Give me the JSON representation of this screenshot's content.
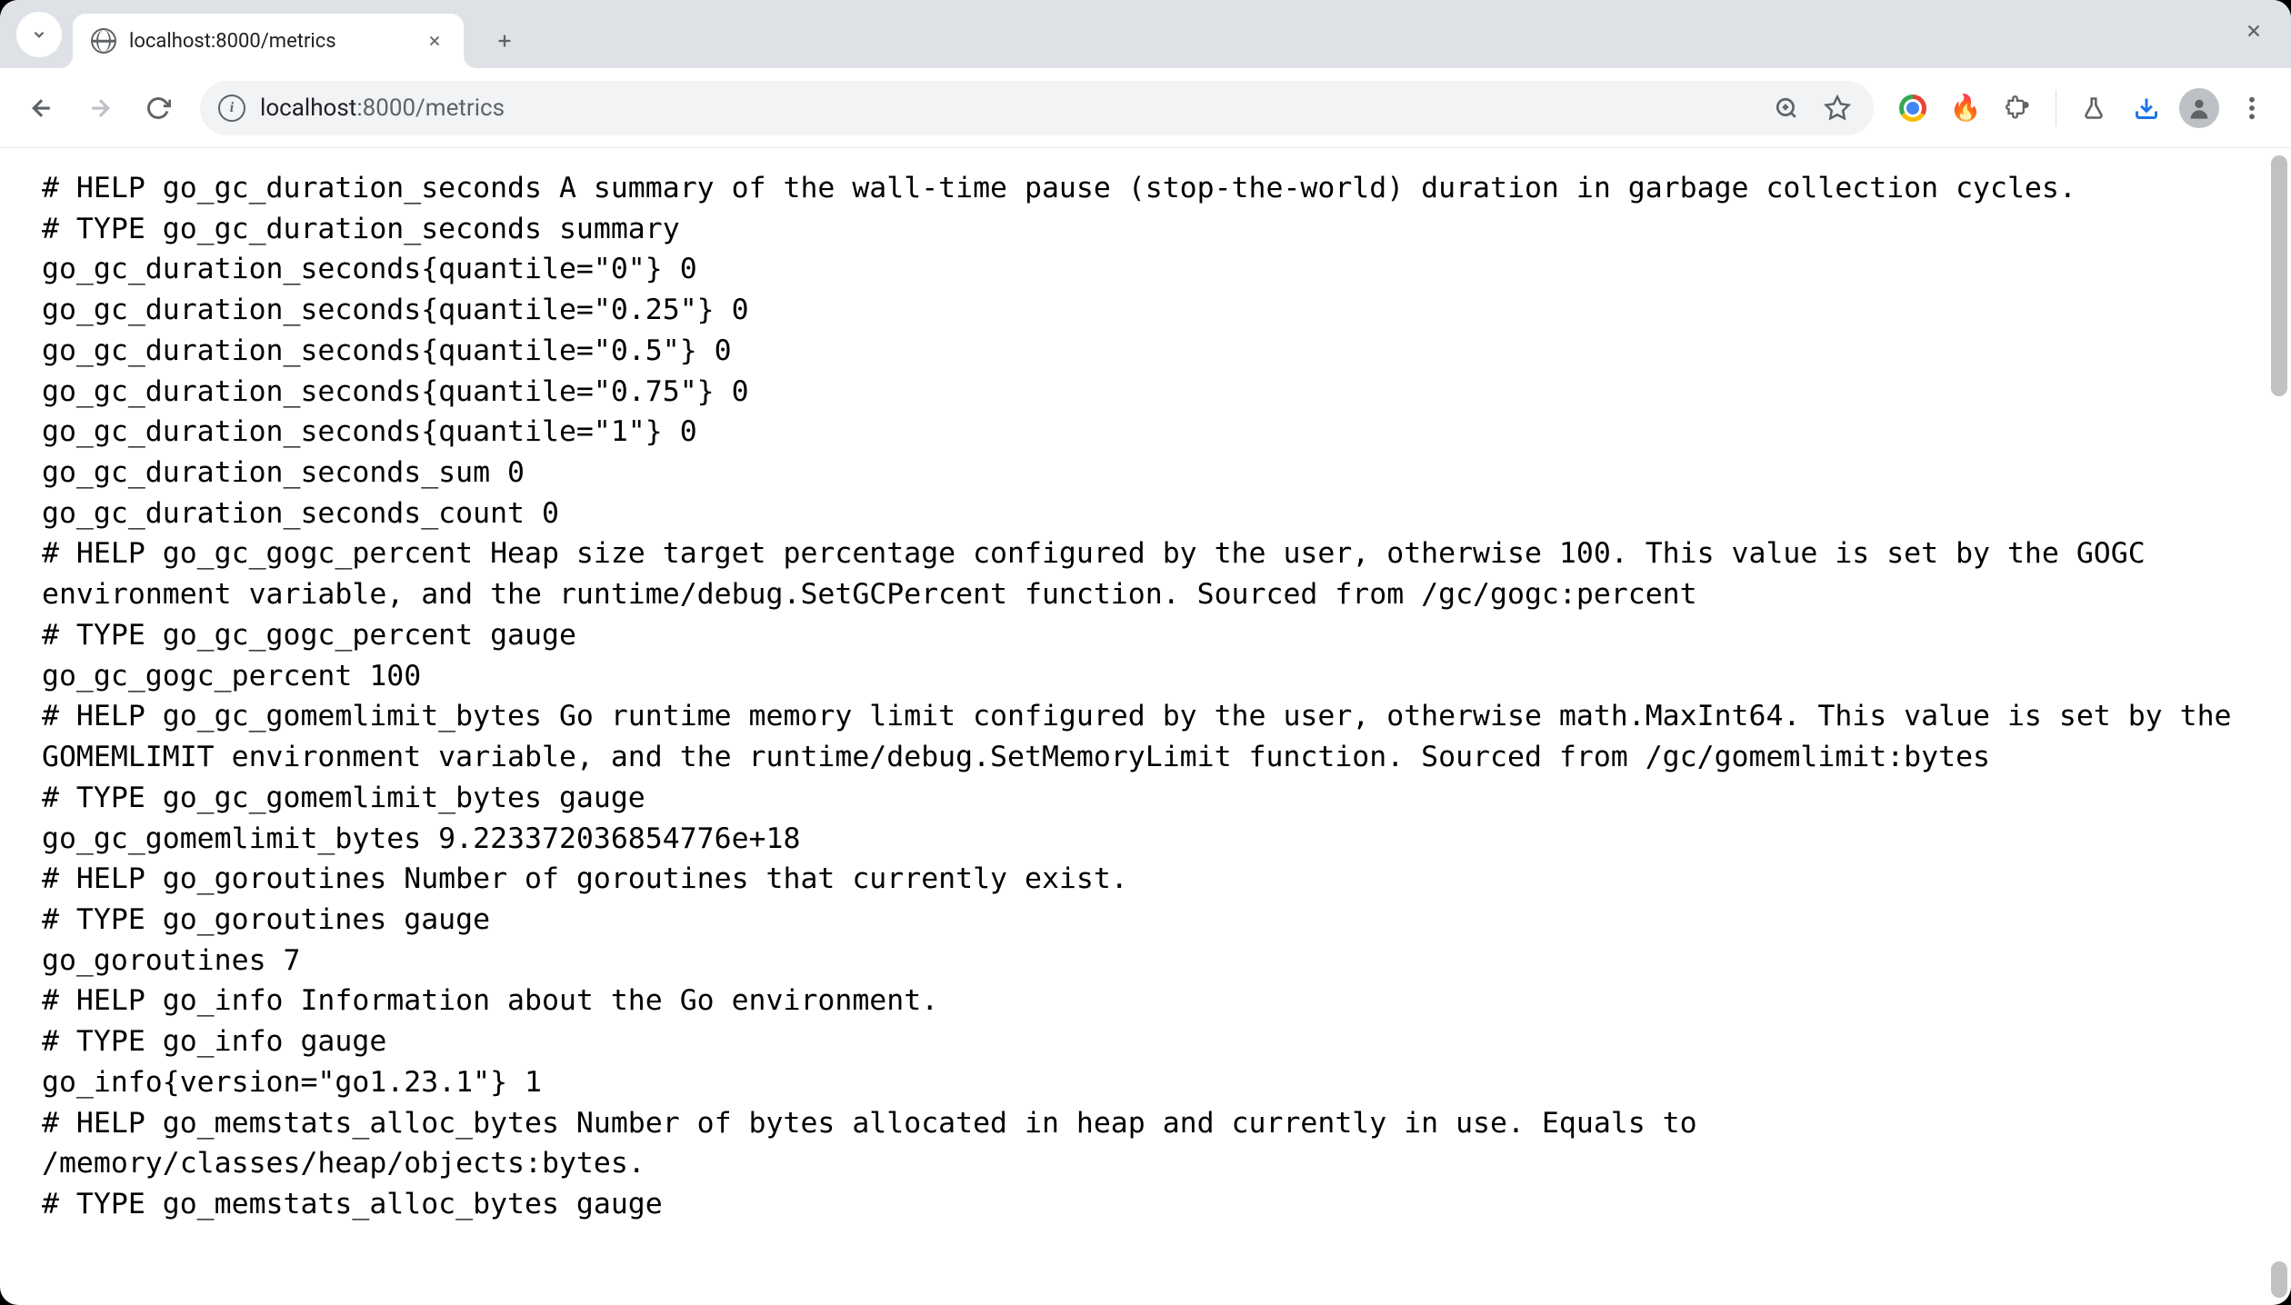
{
  "tab": {
    "title": "localhost:8000/metrics"
  },
  "omnibox": {
    "host": "localhost",
    "port_path": ":8000/metrics"
  },
  "metrics_text": "# HELP go_gc_duration_seconds A summary of the wall-time pause (stop-the-world) duration in garbage collection cycles.\n# TYPE go_gc_duration_seconds summary\ngo_gc_duration_seconds{quantile=\"0\"} 0\ngo_gc_duration_seconds{quantile=\"0.25\"} 0\ngo_gc_duration_seconds{quantile=\"0.5\"} 0\ngo_gc_duration_seconds{quantile=\"0.75\"} 0\ngo_gc_duration_seconds{quantile=\"1\"} 0\ngo_gc_duration_seconds_sum 0\ngo_gc_duration_seconds_count 0\n# HELP go_gc_gogc_percent Heap size target percentage configured by the user, otherwise 100. This value is set by the GOGC environment variable, and the runtime/debug.SetGCPercent function. Sourced from /gc/gogc:percent\n# TYPE go_gc_gogc_percent gauge\ngo_gc_gogc_percent 100\n# HELP go_gc_gomemlimit_bytes Go runtime memory limit configured by the user, otherwise math.MaxInt64. This value is set by the GOMEMLIMIT environment variable, and the runtime/debug.SetMemoryLimit function. Sourced from /gc/gomemlimit:bytes\n# TYPE go_gc_gomemlimit_bytes gauge\ngo_gc_gomemlimit_bytes 9.223372036854776e+18\n# HELP go_goroutines Number of goroutines that currently exist.\n# TYPE go_goroutines gauge\ngo_goroutines 7\n# HELP go_info Information about the Go environment.\n# TYPE go_info gauge\ngo_info{version=\"go1.23.1\"} 1\n# HELP go_memstats_alloc_bytes Number of bytes allocated in heap and currently in use. Equals to /memory/classes/heap/objects:bytes.\n# TYPE go_memstats_alloc_bytes gauge"
}
